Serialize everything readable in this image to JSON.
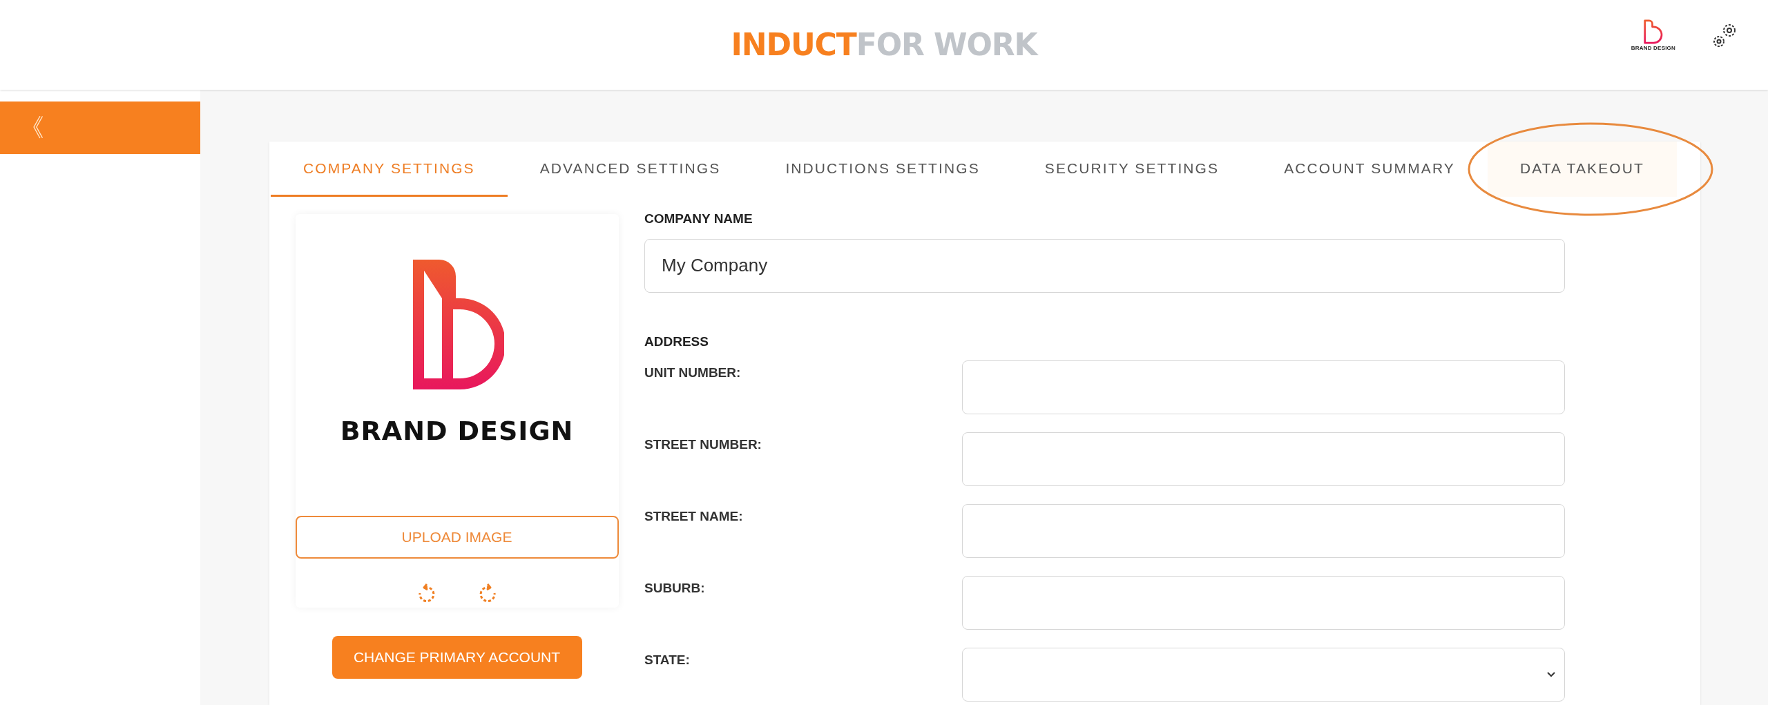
{
  "header": {
    "logo": {
      "part_1": "INDUCT",
      "part_2": "FOR WORK"
    },
    "account_logo": {
      "text": "BRAND DESIGN"
    }
  },
  "sidebar": {
    "toggle": "《"
  },
  "tabs": [
    {
      "label": "COMPANY SETTINGS",
      "selected": true
    },
    {
      "label": "ADVANCED SETTINGS",
      "selected": false
    },
    {
      "label": "INDUCTIONS SETTINGS",
      "selected": false
    },
    {
      "label": "SECURITY SETTINGS",
      "selected": false
    },
    {
      "label": "ACCOUNT SUMMARY",
      "selected": false
    },
    {
      "label": "DATA TAKEOUT",
      "selected": false,
      "highlighted": true
    }
  ],
  "logo_panel": {
    "logo_text": "BRAND DESIGN",
    "upload_button": "UPLOAD IMAGE",
    "primary_button": "CHANGE PRIMARY ACCOUNT"
  },
  "company_name": {
    "label": "COMPANY NAME",
    "value": "My Company"
  },
  "address": {
    "heading": "ADDRESS",
    "fields": [
      {
        "label": "UNIT NUMBER:",
        "kind": "text"
      },
      {
        "label": "STREET NUMBER:",
        "kind": "text"
      },
      {
        "label": "STREET NAME:",
        "kind": "text"
      },
      {
        "label": "SUBURB:",
        "kind": "text"
      },
      {
        "label": "STATE:",
        "kind": "select"
      }
    ]
  }
}
